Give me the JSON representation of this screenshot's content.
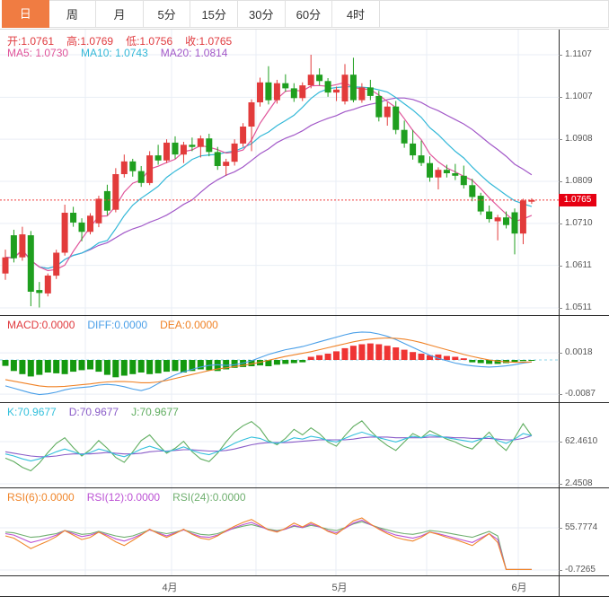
{
  "toolbar": {
    "tabs": [
      {
        "label": "日",
        "active": true
      },
      {
        "label": "周",
        "active": false
      },
      {
        "label": "月",
        "active": false
      },
      {
        "label": "5分",
        "active": false
      },
      {
        "label": "15分",
        "active": false
      },
      {
        "label": "30分",
        "active": false
      },
      {
        "label": "60分",
        "active": false
      },
      {
        "label": "4时",
        "active": false
      }
    ]
  },
  "legends": {
    "ohlc": {
      "open": "开:1.0761",
      "high": "高:1.0769",
      "low": "低:1.0756",
      "close": "收:1.0765"
    },
    "ma": {
      "ma5": "MA5: 1.0730",
      "ma10": "MA10: 1.0743",
      "ma20": "MA20: 1.0814"
    },
    "macd": {
      "macd": "MACD:0.0000",
      "diff": "DIFF:0.0000",
      "dea": "DEA:0.0000"
    },
    "kdj": {
      "k": "K:70.9677",
      "d": "D:70.9677",
      "j": "J:70.9677"
    },
    "rsi": {
      "rsi6": "RSI(6):0.0000",
      "rsi12": "RSI(12):0.0000",
      "rsi24": "RSI(24):0.0000"
    }
  },
  "colors": {
    "up": "#e23b3b",
    "down": "#1f9f1f",
    "ma5": "#e0549a",
    "ma10": "#33b8d8",
    "ma20": "#a258c8",
    "ohlc_text": "#e03a3e",
    "macd_label": "#e03a3e",
    "diff": "#4a9fe8",
    "dea": "#f08226",
    "hist_up": "#ef3434",
    "hist_down": "#14990f",
    "macd_zero": "#8fd4e8",
    "k": "#33c0dc",
    "d": "#8a5cc8",
    "j": "#5fad5f",
    "rsi6": "#f0862b",
    "rsi12": "#bc52d4",
    "rsi24": "#6faf6f",
    "price_line": "#f13a3a",
    "badge_bg": "#e60012",
    "badge_text": "#ffffff",
    "tab_active_bg": "#f07c42",
    "grid": "#e9eef5",
    "axis_text": "#555555"
  },
  "chart_data": {
    "type": "candlestick",
    "title": "",
    "x_axis": {
      "labels": [
        "4月",
        "5月",
        "6月"
      ]
    },
    "panes": [
      {
        "name": "price",
        "type": "candlestick",
        "axis_labels": [
          "1.1107",
          "1.1007",
          "1.0908",
          "1.0809",
          "1.0710",
          "1.0611",
          "1.0511"
        ],
        "current_price": "1.0765",
        "ylim": [
          1.0511,
          1.1107
        ],
        "candles": [
          [
            1.0592,
            1.0648,
            1.0577,
            1.063
          ],
          [
            1.0682,
            1.0695,
            1.0618,
            1.0628
          ],
          [
            1.063,
            1.0702,
            1.0622,
            1.0684
          ],
          [
            1.0682,
            1.0692,
            1.0515,
            1.0549
          ],
          [
            1.0553,
            1.0572,
            1.0512,
            1.0546
          ],
          [
            1.0545,
            1.0592,
            1.0538,
            1.0587
          ],
          [
            1.0587,
            1.0648,
            1.0579,
            1.0641
          ],
          [
            1.0641,
            1.0754,
            1.0634,
            1.0735
          ],
          [
            1.0735,
            1.0749,
            1.0702,
            1.0712
          ],
          [
            1.0712,
            1.0722,
            1.0668,
            1.069
          ],
          [
            1.069,
            1.0734,
            1.0684,
            1.0728
          ],
          [
            1.071,
            1.0775,
            1.0701,
            1.0768
          ],
          [
            1.0786,
            1.0801,
            1.0729,
            1.074
          ],
          [
            1.0742,
            1.084,
            1.0736,
            1.0826
          ],
          [
            1.0826,
            1.0872,
            1.0818,
            1.0856
          ],
          [
            1.0856,
            1.0862,
            1.082,
            1.0833
          ],
          [
            1.0833,
            1.0845,
            1.0796,
            1.0805
          ],
          [
            1.0805,
            1.088,
            1.08,
            1.087
          ],
          [
            1.087,
            1.0895,
            1.0848,
            1.0858
          ],
          [
            1.0858,
            1.0908,
            1.0852,
            1.09
          ],
          [
            1.09,
            1.0915,
            1.0862,
            1.0872
          ],
          [
            1.0872,
            1.0902,
            1.0852,
            1.0895
          ],
          [
            1.0895,
            1.0912,
            1.088,
            1.089
          ],
          [
            1.089,
            1.0917,
            1.0865,
            1.091
          ],
          [
            1.091,
            1.0921,
            1.0868,
            1.0878
          ],
          [
            1.0878,
            1.089,
            1.0836,
            1.0845
          ],
          [
            1.0845,
            1.0862,
            1.0822,
            1.0855
          ],
          [
            1.0855,
            1.0908,
            1.0846,
            1.0898
          ],
          [
            1.0898,
            1.0946,
            1.089,
            1.0938
          ],
          [
            1.0938,
            1.1002,
            1.088,
            1.0995
          ],
          [
            1.0995,
            1.1053,
            1.0985,
            1.1042
          ],
          [
            1.1042,
            1.108,
            1.099,
            1.1
          ],
          [
            1.1,
            1.1048,
            1.0992,
            1.104
          ],
          [
            1.104,
            1.1061,
            1.102,
            1.1028
          ],
          [
            1.1028,
            1.104,
            1.0996,
            1.1005
          ],
          [
            1.1005,
            1.1042,
            1.0998,
            1.1035
          ],
          [
            1.1035,
            1.1107,
            1.1028,
            1.106
          ],
          [
            1.106,
            1.1075,
            1.1035,
            1.1045
          ],
          [
            1.1045,
            1.1052,
            1.1008,
            1.1018
          ],
          [
            1.1018,
            1.1032,
            1.0998,
            1.1025
          ],
          [
            1.0997,
            1.1085,
            1.099,
            1.106
          ],
          [
            1.106,
            1.11,
            1.0995,
            1.1
          ],
          [
            1.1,
            1.104,
            1.0994,
            1.103
          ],
          [
            1.103,
            1.1048,
            1.1,
            1.101
          ],
          [
            1.101,
            1.1022,
            1.095,
            1.096
          ],
          [
            1.096,
            1.0995,
            1.094,
            1.0985
          ],
          [
            1.0985,
            1.0998,
            1.092,
            1.093
          ],
          [
            1.093,
            1.0952,
            1.0888,
            1.0898
          ],
          [
            1.0898,
            1.093,
            1.086,
            1.087
          ],
          [
            1.087,
            1.0905,
            1.0845,
            1.0852
          ],
          [
            1.0852,
            1.0868,
            1.0808,
            1.0818
          ],
          [
            1.0818,
            1.0842,
            1.079,
            1.0836
          ],
          [
            1.0836,
            1.0848,
            1.0818,
            1.0828
          ],
          [
            1.0828,
            1.085,
            1.0812,
            1.0822
          ],
          [
            1.0822,
            1.0846,
            1.0792,
            1.08
          ],
          [
            1.08,
            1.0815,
            1.0762,
            1.0772
          ],
          [
            1.0775,
            1.0782,
            1.073,
            1.0738
          ],
          [
            1.0738,
            1.0752,
            1.0712,
            1.072
          ],
          [
            1.0715,
            1.073,
            1.067,
            1.0724
          ],
          [
            1.0724,
            1.0738,
            1.0698,
            1.0706
          ],
          [
            1.0736,
            1.0745,
            1.0637,
            1.0686
          ],
          [
            1.0686,
            1.0768,
            1.0661,
            1.0764
          ],
          [
            1.0761,
            1.0769,
            1.0756,
            1.0765
          ]
        ]
      },
      {
        "name": "macd",
        "type": "histogram_lines",
        "axis_labels": [
          "0.0018",
          "-0.0087"
        ],
        "histogram": [
          -0.0015,
          -0.0028,
          -0.0036,
          -0.0042,
          -0.0038,
          -0.0032,
          -0.0034,
          -0.0036,
          -0.003,
          -0.0026,
          -0.0024,
          -0.003,
          -0.0038,
          -0.0044,
          -0.004,
          -0.0036,
          -0.0032,
          -0.0036,
          -0.0034,
          -0.003,
          -0.0028,
          -0.0032,
          -0.0028,
          -0.0024,
          -0.0026,
          -0.0028,
          -0.0024,
          -0.002,
          -0.0018,
          -0.0016,
          -0.0014,
          -0.0016,
          -0.0012,
          -0.001,
          -0.0008,
          -0.0006,
          0.0008,
          0.0012,
          0.0016,
          0.0022,
          0.003,
          0.0036,
          0.004,
          0.0042,
          0.004,
          0.0036,
          0.0032,
          0.0026,
          0.002,
          0.0016,
          0.0012,
          0.0014,
          0.001,
          0.0008,
          0.0004,
          -0.0006,
          -0.0008,
          -0.001,
          -0.001,
          -0.0008,
          -0.0006,
          -0.0003,
          -0.0001
        ],
        "diff": [
          -0.0066,
          -0.0072,
          -0.0078,
          -0.0084,
          -0.0088,
          -0.0086,
          -0.0082,
          -0.0076,
          -0.0072,
          -0.007,
          -0.0068,
          -0.0064,
          -0.0062,
          -0.0064,
          -0.0068,
          -0.0074,
          -0.0078,
          -0.0072,
          -0.006,
          -0.0048,
          -0.0038,
          -0.003,
          -0.0024,
          -0.0018,
          -0.0014,
          -0.0012,
          -0.0014,
          -0.0012,
          -0.0008,
          -0.0002,
          0.0006,
          0.0014,
          0.002,
          0.0026,
          0.003,
          0.0034,
          0.004,
          0.0046,
          0.0052,
          0.0058,
          0.0064,
          0.0069,
          0.0071,
          0.007,
          0.0066,
          0.006,
          0.0052,
          0.0042,
          0.0032,
          0.0022,
          0.0012,
          0.0004,
          -0.0002,
          -0.0008,
          -0.0012,
          -0.0015,
          -0.0017,
          -0.0018,
          -0.0017,
          -0.0015,
          -0.0012,
          -0.0008,
          -0.0005
        ],
        "dea": [
          -0.005,
          -0.0054,
          -0.0058,
          -0.0062,
          -0.0066,
          -0.0068,
          -0.0068,
          -0.0067,
          -0.0065,
          -0.0063,
          -0.0061,
          -0.0058,
          -0.0056,
          -0.0055,
          -0.0055,
          -0.0056,
          -0.0058,
          -0.0058,
          -0.0056,
          -0.0052,
          -0.0047,
          -0.0042,
          -0.0037,
          -0.0032,
          -0.0027,
          -0.0023,
          -0.002,
          -0.0017,
          -0.0014,
          -0.001,
          -0.0006,
          -0.0001,
          0.0004,
          0.0009,
          0.0013,
          0.0017,
          0.0021,
          0.0026,
          0.0031,
          0.0036,
          0.0041,
          0.0046,
          0.005,
          0.0053,
          0.0055,
          0.0056,
          0.0055,
          0.0053,
          0.0049,
          0.0044,
          0.0038,
          0.0032,
          0.0026,
          0.002,
          0.0014,
          0.0009,
          0.0004,
          0.0,
          -0.0003,
          -0.0005,
          -0.0006,
          -0.0006,
          -0.0005
        ]
      },
      {
        "name": "kdj",
        "type": "lines",
        "axis_labels": [
          "62.4610",
          "2.4508"
        ],
        "k": [
          45,
          42,
          38,
          35,
          38,
          43,
          48,
          52,
          48,
          44,
          47,
          52,
          49,
          44,
          41,
          46,
          52,
          56,
          52,
          48,
          51,
          55,
          50,
          46,
          44,
          48,
          54,
          60,
          65,
          69,
          67,
          62,
          60,
          63,
          68,
          66,
          70,
          68,
          64,
          62,
          67,
          72,
          76,
          72,
          68,
          65,
          62,
          66,
          70,
          68,
          72,
          70,
          68,
          66,
          64,
          62,
          66,
          70,
          64,
          60,
          66,
          74,
          71
        ],
        "d": [
          48,
          46,
          44,
          42,
          41,
          41,
          42,
          44,
          45,
          45,
          45,
          46,
          47,
          46,
          45,
          45,
          46,
          48,
          49,
          49,
          50,
          51,
          51,
          50,
          49,
          49,
          50,
          52,
          55,
          58,
          60,
          61,
          61,
          61,
          62,
          63,
          64,
          65,
          65,
          65,
          65,
          66,
          68,
          69,
          69,
          69,
          68,
          68,
          68,
          68,
          69,
          69,
          69,
          68,
          68,
          67,
          67,
          67,
          66,
          65,
          65,
          67,
          71
        ],
        "j": [
          39,
          34,
          26,
          21,
          32,
          47,
          60,
          68,
          54,
          42,
          51,
          64,
          53,
          40,
          33,
          48,
          64,
          72,
          58,
          46,
          53,
          63,
          48,
          38,
          34,
          46,
          62,
          76,
          85,
          91,
          81,
          64,
          58,
          67,
          80,
          72,
          82,
          74,
          62,
          56,
          71,
          84,
          92,
          78,
          66,
          57,
          50,
          62,
          74,
          68,
          78,
          72,
          66,
          62,
          56,
          52,
          64,
          76,
          60,
          50,
          68,
          88,
          71
        ]
      },
      {
        "name": "rsi",
        "type": "lines",
        "axis_labels": [
          "55.7774",
          "-0.7265"
        ],
        "rsi6": [
          45,
          42,
          35,
          28,
          33,
          38,
          44,
          52,
          46,
          40,
          43,
          50,
          44,
          37,
          32,
          39,
          46,
          54,
          48,
          43,
          48,
          54,
          47,
          42,
          40,
          45,
          52,
          58,
          63,
          67,
          60,
          53,
          50,
          55,
          62,
          57,
          63,
          58,
          51,
          47,
          56,
          65,
          69,
          61,
          54,
          48,
          43,
          40,
          38,
          43,
          50,
          47,
          43,
          40,
          36,
          32,
          40,
          48,
          36,
          0,
          0,
          0,
          0
        ],
        "rsi12": [
          48,
          46,
          41,
          36,
          39,
          42,
          46,
          52,
          48,
          44,
          46,
          50,
          46,
          41,
          38,
          42,
          47,
          53,
          49,
          45,
          49,
          53,
          48,
          44,
          43,
          46,
          51,
          56,
          60,
          63,
          58,
          53,
          51,
          54,
          59,
          56,
          61,
          57,
          52,
          49,
          55,
          62,
          66,
          60,
          55,
          50,
          46,
          44,
          42,
          45,
          50,
          48,
          45,
          42,
          39,
          36,
          42,
          48,
          40,
          0,
          0,
          0,
          0
        ],
        "rsi24": [
          50,
          49,
          46,
          43,
          44,
          46,
          48,
          52,
          50,
          47,
          48,
          51,
          48,
          45,
          43,
          45,
          49,
          53,
          50,
          48,
          50,
          53,
          50,
          47,
          46,
          48,
          52,
          55,
          58,
          60,
          57,
          54,
          52,
          54,
          58,
          56,
          59,
          57,
          54,
          52,
          56,
          61,
          64,
          60,
          56,
          53,
          50,
          48,
          47,
          49,
          52,
          51,
          49,
          47,
          45,
          43,
          47,
          51,
          45,
          0,
          0,
          0,
          0
        ]
      }
    ]
  }
}
